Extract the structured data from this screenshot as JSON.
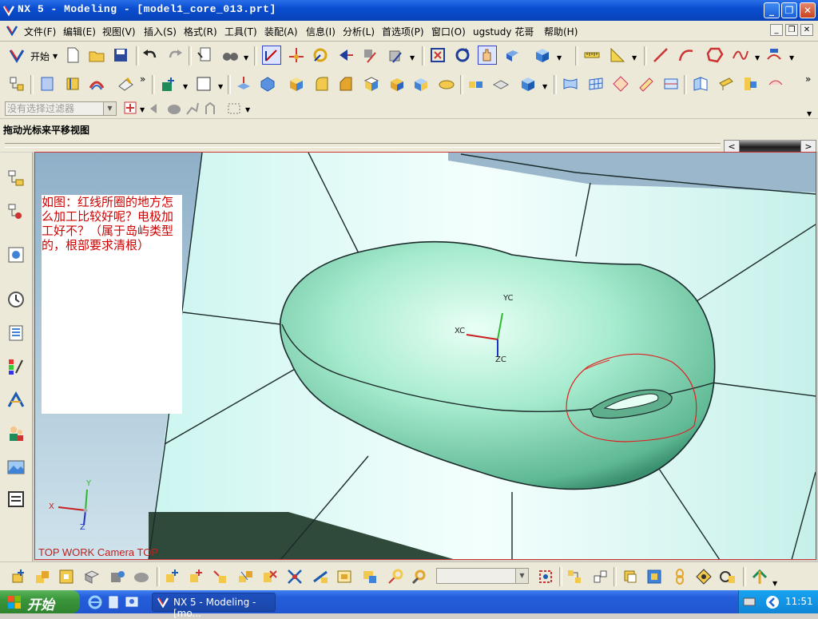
{
  "window": {
    "title": "NX 5 - Modeling - [model1_core_013.prt]"
  },
  "menu": {
    "items": [
      "文件(F)",
      "编辑(E)",
      "视图(V)",
      "插入(S)",
      "格式(R)",
      "工具(T)",
      "装配(A)",
      "信息(I)",
      "分析(L)",
      "首选项(P)",
      "窗口(O)",
      "ugstudy 花哥",
      "帮助(H)"
    ]
  },
  "toolbar": {
    "start_label": "开始",
    "filter_placeholder": "没有选择过滤器"
  },
  "status": {
    "prompt": "拖动光标来平移视图"
  },
  "viewport": {
    "note": "如图：红线所圈的地方怎么加工比较好呢？电极加工好不？（属于岛屿类型的，根部要求清根）",
    "view_label": "TOP WORK Camera TOP",
    "wcs": {
      "x": "XC",
      "y": "YC",
      "z": "ZC"
    },
    "abs_axes": {
      "x": "X",
      "y": "Y",
      "z": "Z"
    }
  },
  "taskbar": {
    "start_label": "开始",
    "task_label": "NX 5 - Modeling - [mo...",
    "clock": "11:51"
  },
  "colors": {
    "accent": "#0a4ed0",
    "annotation": "#d00000",
    "model_body": "#9fe6c8",
    "face_bg": "#d9f7f4"
  }
}
